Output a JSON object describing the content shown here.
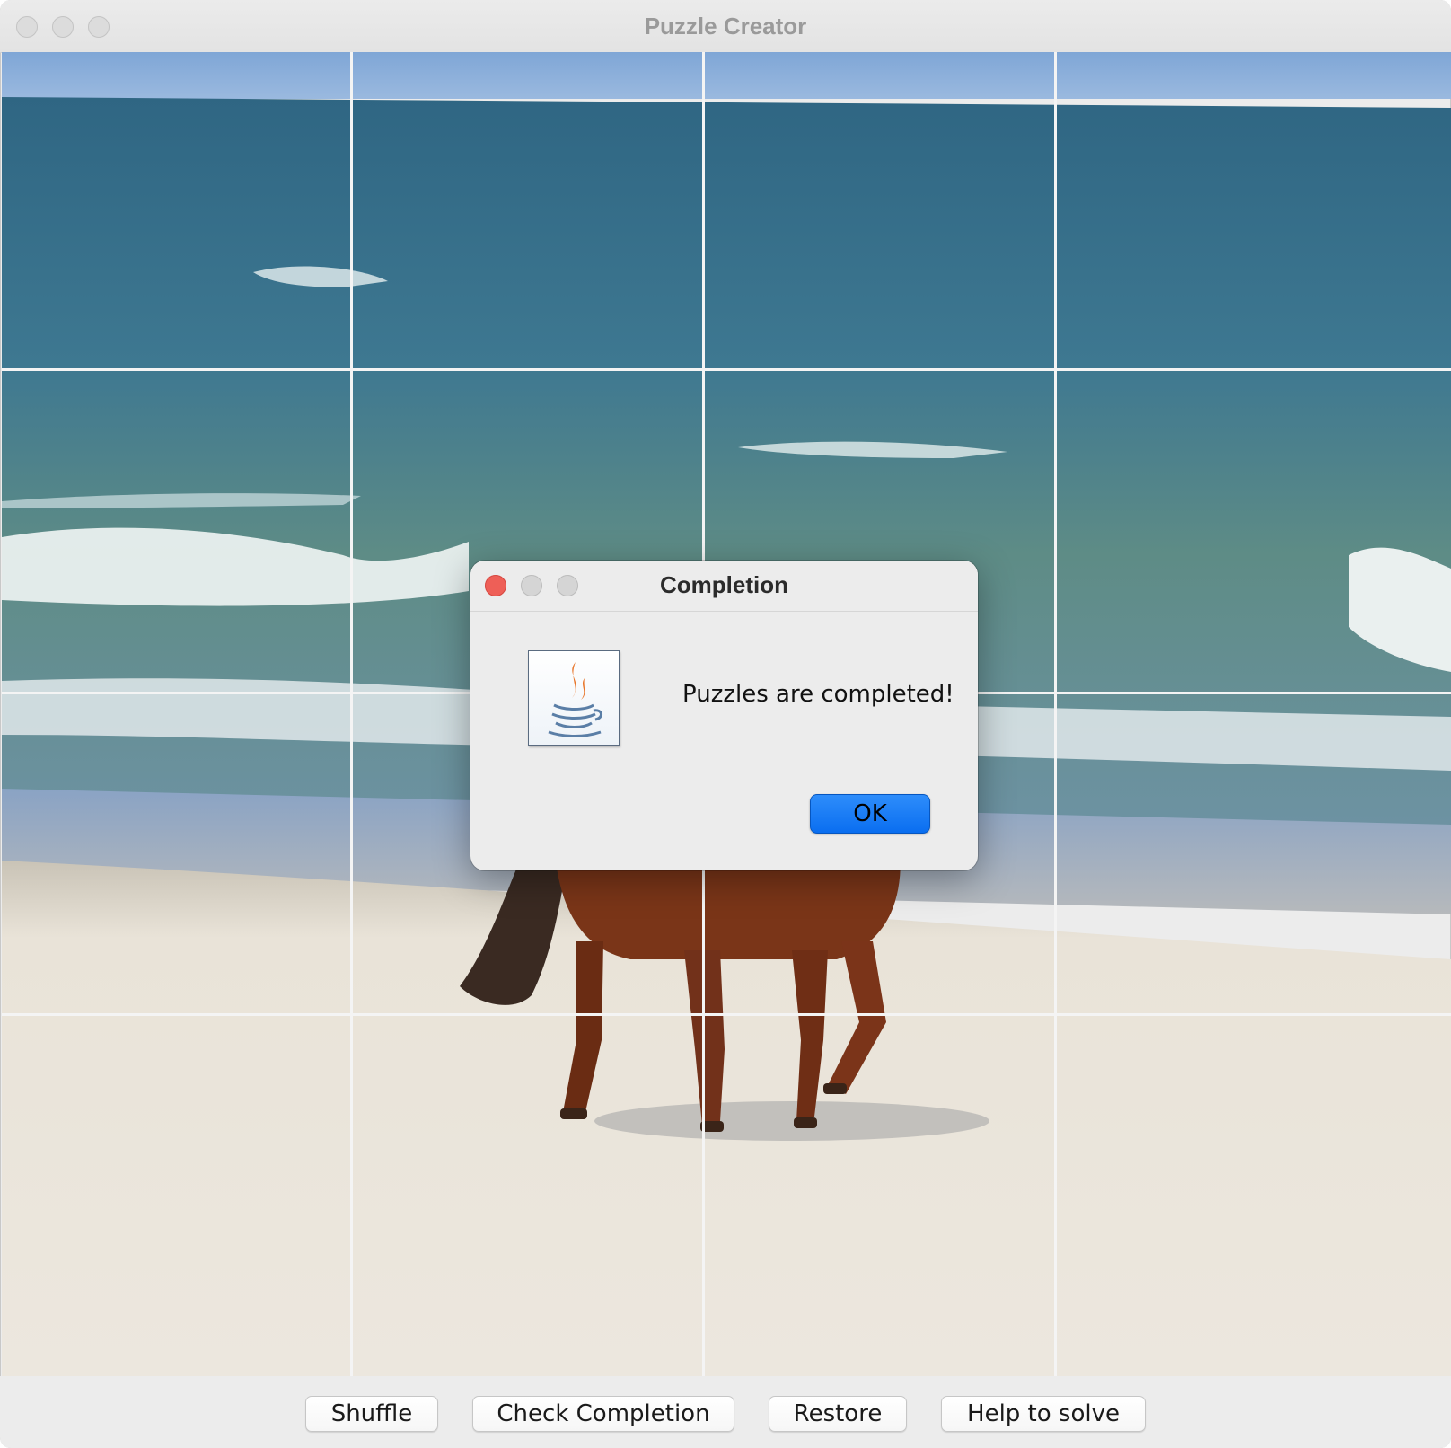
{
  "window": {
    "title": "Puzzle Creator"
  },
  "puzzle": {
    "image": "beach-horse-photo",
    "rows": 4,
    "columns": 4
  },
  "toolbar": {
    "shuffle_label": "Shuffle",
    "check_label": "Check Completion",
    "restore_label": "Restore",
    "help_label": "Help to solve"
  },
  "dialog": {
    "title": "Completion",
    "message": "Puzzles are completed!",
    "ok_label": "OK",
    "icon": "java-icon"
  },
  "colors": {
    "close_red": "#ee5f57",
    "ok_blue": "#1a7cf5",
    "sea": "#3f7691",
    "sand": "#e7e1d6",
    "horse": "#7a3518"
  }
}
